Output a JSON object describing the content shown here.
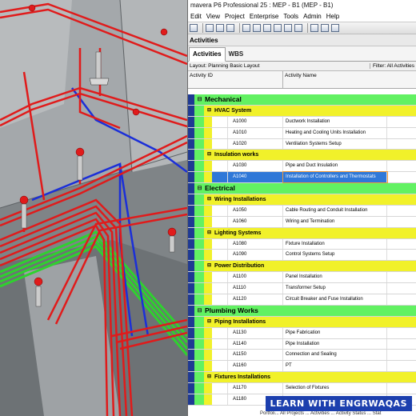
{
  "window": {
    "title": "mavera P6 Professional 25 : MEP - B1 (MEP - B1)"
  },
  "menu": [
    "Edit",
    "View",
    "Project",
    "Enterprise",
    "Tools",
    "Admin",
    "Help"
  ],
  "pane_title": "Activities",
  "tabs": {
    "active": "Activities",
    "other": "WBS"
  },
  "layout_label": "Layout: Planning Basic Layout",
  "filter_label": "Filter: All Activities",
  "columns": {
    "id": "Activity ID",
    "name": "Activity Name"
  },
  "rows": [
    {
      "type": "wbs1",
      "label": "Mechanical"
    },
    {
      "type": "wbs2",
      "label": "HVAC System"
    },
    {
      "type": "act",
      "id": "A1000",
      "name": "Ductwork Installation"
    },
    {
      "type": "act",
      "id": "A1010",
      "name": "Heating and Cooling Units Installation"
    },
    {
      "type": "act",
      "id": "A1020",
      "name": "Ventilation Systems Setup"
    },
    {
      "type": "wbs2",
      "label": "Insulation works"
    },
    {
      "type": "act",
      "id": "A1030",
      "name": "Pipe and Duct Insulation"
    },
    {
      "type": "act",
      "id": "A1040",
      "name": "Installation of Controllers and Thermostats",
      "selected": true
    },
    {
      "type": "wbs1",
      "label": "Electrical"
    },
    {
      "type": "wbs2",
      "label": "Wiring Installations"
    },
    {
      "type": "act",
      "id": "A1050",
      "name": "Cable Routing and Conduit Installation"
    },
    {
      "type": "act",
      "id": "A1060",
      "name": "Wiring and Termination"
    },
    {
      "type": "wbs2",
      "label": "Lighting Systems"
    },
    {
      "type": "act",
      "id": "A1080",
      "name": "Fixture Installation"
    },
    {
      "type": "act",
      "id": "A1090",
      "name": "Control Systems Setup"
    },
    {
      "type": "wbs2",
      "label": "Power Distribution"
    },
    {
      "type": "act",
      "id": "A1100",
      "name": "Panel Installation"
    },
    {
      "type": "act",
      "id": "A1110",
      "name": "Transformer Setup"
    },
    {
      "type": "act",
      "id": "A1120",
      "name": "Circuit Breaker and Fuse Installation"
    },
    {
      "type": "wbs1",
      "label": "Plumbing Works"
    },
    {
      "type": "wbs2",
      "label": "Piping Installations"
    },
    {
      "type": "act",
      "id": "A1130",
      "name": "Pipe Fabrication"
    },
    {
      "type": "act",
      "id": "A1140",
      "name": "Pipe Installation"
    },
    {
      "type": "act",
      "id": "A1150",
      "name": "Connection and Sealing"
    },
    {
      "type": "act",
      "id": "A1160",
      "name": "PT"
    },
    {
      "type": "wbs2",
      "label": "Fixtures Installations"
    },
    {
      "type": "act",
      "id": "A1170",
      "name": "Selection of Fixtures"
    },
    {
      "type": "act",
      "id": "A1180",
      "name": ""
    }
  ],
  "bottom_tabs": "Portfoli... All Projects ... Activities ... Activity Status ... Stat",
  "watermark": "LEARN WITH ENGRWAQAS",
  "colors": {
    "wbs1": "#62f162",
    "wbs2": "#f1f12a",
    "selection": "#2f78d8",
    "pipe_red": "#e01b1b",
    "pipe_blue": "#1b2fd8",
    "pipe_green": "#2fd12f"
  }
}
